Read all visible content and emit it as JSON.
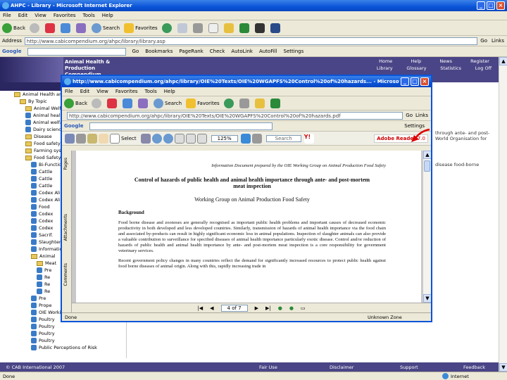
{
  "outer": {
    "title": "AHPC - Library - Microsoft Internet Explorer",
    "menu": [
      "File",
      "Edit",
      "View",
      "Favorites",
      "Tools",
      "Help"
    ],
    "toolbar": {
      "back": "Back",
      "search": "Search",
      "favorites": "Favorites"
    },
    "address_label": "Address",
    "address_value": "http://www.cabicompendium.org/ahpc/library/library.asp",
    "go_label": "Go",
    "links_label": "Links",
    "google_label": "Google",
    "google_tools": [
      "Go",
      "Bookmarks",
      "PageRank",
      "Check",
      "AutoLink",
      "AutoFill",
      "Settings"
    ],
    "banner": {
      "title_lines": [
        "Animal Health &",
        "Production",
        "Compendium"
      ],
      "nav_top": [
        "Home",
        "Help",
        "News",
        "Register"
      ],
      "nav_bottom": [
        "Library",
        "Glossary",
        "Statistics",
        "Log Off"
      ]
    },
    "sidebar": {
      "header": "Animal Health and Production",
      "items": [
        "By Topic",
        "Animal Welfare",
        "Animal health",
        "Animal welfare",
        "Dairy science",
        "Disease",
        "Food safety",
        "Farming systems",
        "Food Safety",
        "Bi-Functional",
        "Cattle",
        "Cattle",
        "Cattle",
        "Codex Alimentarius",
        "Codex Alimentarius",
        "Food",
        "Codex",
        "Codex",
        "Codex",
        "Sacrif.",
        "Slaughter",
        "Information",
        "Animal",
        "Meat",
        "Pre",
        "Re",
        "Re",
        "Re",
        "Pre",
        "Prope",
        "OIE Working Group on Animal Production",
        "Poultry",
        "Poultry",
        "Poultry",
        "Poultry",
        "Public Perceptions of Risk"
      ]
    },
    "right_texts": [
      "through ante- and post-",
      "World Organisation for",
      "disease food-borne"
    ],
    "footer": [
      "© CAB International 2007",
      "Fair Use",
      "Disclaimer",
      "Support",
      "Feedback"
    ],
    "status": "Done",
    "status_zone": "Internet"
  },
  "inner": {
    "title": "http://www.cabicompendium.org/ahpc/library/OIE%20Texts/OIE%20WGAPFS%20Control%20of%20hazards... - Microsoft Internet Explorer",
    "menu": [
      "File",
      "Edit",
      "View",
      "Favorites",
      "Tools",
      "Help"
    ],
    "toolbar": {
      "back": "Back",
      "search": "Search",
      "favorites": "Favorites"
    },
    "address_value": "http://www.cabicompendium.org/ahpc/library/OIE%20Texts/OIE%20WGAPFS%20Control%20of%20hazards.pdf",
    "go_label": "Go",
    "links_label": "Links",
    "google_label": "Google",
    "google_settings": "Settings",
    "pdf_toolbar": {
      "select": "Select",
      "zoom": "125%",
      "search": "Search"
    },
    "side_tabs": [
      "Pages",
      "Attachments",
      "Comments"
    ],
    "adobe_label": "Adobe Reader",
    "adobe_version": "7.0",
    "page_nav": "4 of 7",
    "status": "Done",
    "status_zone": "Unknown Zone",
    "document": {
      "header": "Information Document prepared by the OIE Working Group on Animal Production Food Safety",
      "title": "Control of hazards of public health and animal health importance through ante- and post-mortem meat inspection",
      "subtitle": "Working Group on Animal Production Food Safety",
      "section": "Background",
      "para1": "Food borne disease and zoonoses are generally recognised as important public health problems and important causes of decreased economic productivity in both developed and less developed countries. Similarly, transmission of hazards of animal health importance via the food chain and associated by-products can result in highly significant economic loss in animal populations. Inspection of slaughter animals can also provide a valuable contribution to surveillance for specified diseases of animal health importance particularly exotic disease. Control and/or reduction of hazards of public health and animal health importance by ante- and post-mortem meat inspection is a core responsibility for government veterinary services.",
      "para2": "Recent government policy changes in many countries reflect the demand for significantly increased resources to protect public health against food borne diseases of animal origin. Along with this, rapidly increasing trade in"
    }
  },
  "colors": {
    "xp_blue": "#0a54d8",
    "banner": "#4a4586",
    "chrome": "#ece9d8"
  }
}
